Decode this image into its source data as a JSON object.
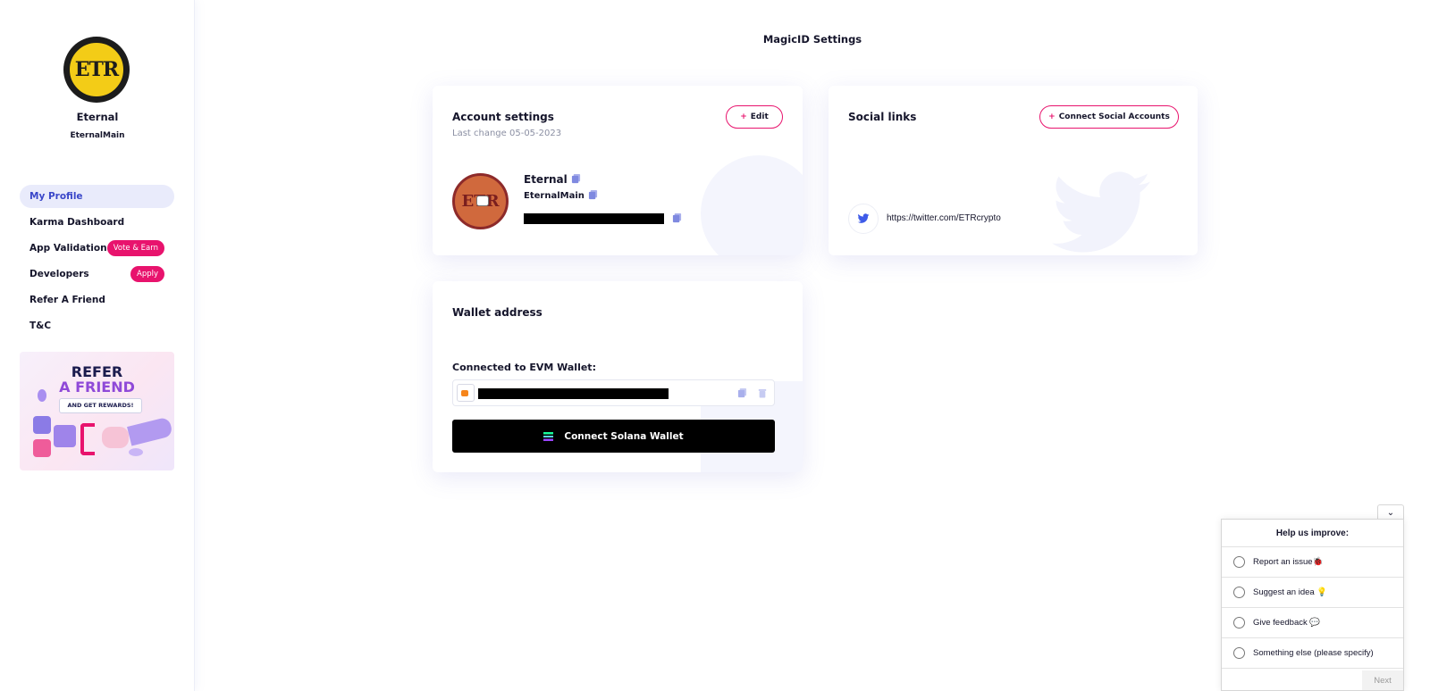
{
  "page": {
    "title": "MagicID Settings"
  },
  "sidebar": {
    "logo_text": "ETR",
    "name": "Eternal",
    "handle": "EternalMain",
    "items": [
      {
        "label": "My Profile",
        "active": true
      },
      {
        "label": "Karma Dashboard"
      },
      {
        "label": "App Validation",
        "badge": "Vote & Earn"
      },
      {
        "label": "Developers",
        "badge": "Apply"
      },
      {
        "label": "Refer A Friend"
      },
      {
        "label": "T&C"
      }
    ],
    "banner": {
      "line1": "REFER",
      "line2": "A FRIEND",
      "sub": "AND GET REWARDS!"
    }
  },
  "account": {
    "title": "Account settings",
    "last_change": "Last change 05-05-2023",
    "edit_label": "Edit",
    "name": "Eternal",
    "handle": "EternalMain",
    "avatar_text": "ETR"
  },
  "social": {
    "title": "Social links",
    "connect_label": "Connect Social Accounts",
    "twitter_url": "https://twitter.com/ETRcrypto"
  },
  "wallet": {
    "title": "Wallet address",
    "evm_label": "Connected to EVM Wallet:",
    "solana_button": "Connect Solana Wallet"
  },
  "feedback": {
    "title": "Help us improve:",
    "options": [
      "Report an issue🐞",
      "Suggest an idea 💡",
      "Give feedback 💬",
      "Something else (please specify)"
    ],
    "next_label": "Next"
  },
  "colors": {
    "accent_pink": "#e8136d",
    "active_blue": "#3a47c9",
    "active_bg": "#e9ebfb"
  }
}
